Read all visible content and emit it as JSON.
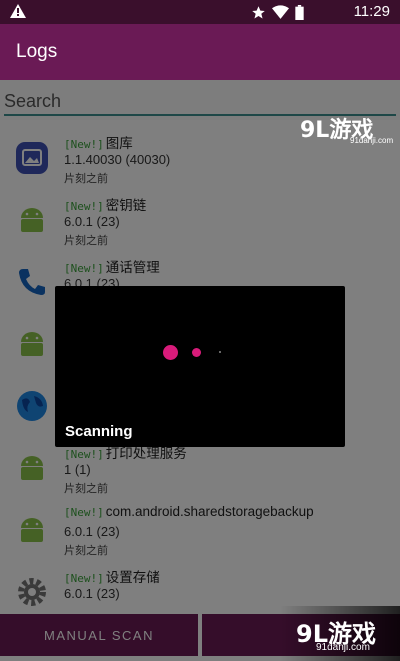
{
  "status_bar": {
    "time": "11:29",
    "icons": [
      "warning-icon",
      "star-icon",
      "wifi-icon",
      "battery-icon"
    ]
  },
  "app_bar": {
    "title": "Logs"
  },
  "search": {
    "placeholder": "Search"
  },
  "apps": [
    {
      "new_tag": "[New!]",
      "name": "图库",
      "version": "1.1.40030 (40030)",
      "time": "片刻之前",
      "icon": "gallery-icon"
    },
    {
      "new_tag": "[New!]",
      "name": "密钥链",
      "version": "6.0.1 (23)",
      "time": "片刻之前",
      "icon": "android-icon"
    },
    {
      "new_tag": "[New!]",
      "name": "通话管理",
      "version": "6.0.1 (23)",
      "time": "",
      "icon": "phone-icon"
    },
    {
      "new_tag": "",
      "name": "",
      "version": "",
      "time": "",
      "icon": "android-icon"
    },
    {
      "new_tag": "",
      "name": "",
      "version": "",
      "time": "",
      "icon": "globe-icon"
    },
    {
      "new_tag": "[New!]",
      "name": "打印处理服务",
      "version": "1 (1)",
      "time": "片刻之前",
      "icon": "android-icon"
    },
    {
      "new_tag": "[New!]",
      "name": "com.android.sharedstoragebackup",
      "version": "6.0.1 (23)",
      "time": "片刻之前",
      "icon": "android-icon"
    },
    {
      "new_tag": "[New!]",
      "name": "设置存储",
      "version": "6.0.1 (23)",
      "time": "",
      "icon": "gear-icon"
    }
  ],
  "bottom": {
    "manual_scan_label": "MANUAL SCAN"
  },
  "dialog": {
    "label": "Scanning",
    "accent": "#d81b7a"
  },
  "watermark": {
    "logo": "9L游戏",
    "url": "91danji.com"
  },
  "colors": {
    "primary": "#6a1a55",
    "status_bar": "#3a0f2c",
    "new_tag": "#3ba13b",
    "search_underline": "#3d8e8e"
  }
}
